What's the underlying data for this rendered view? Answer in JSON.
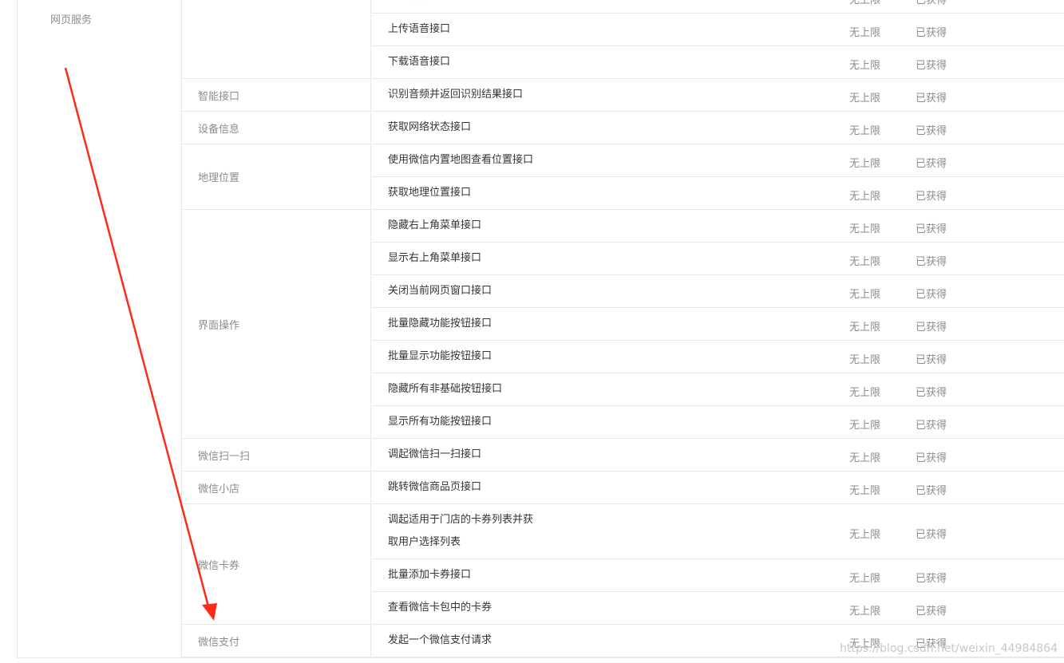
{
  "section": {
    "label": "网页服务"
  },
  "categories": [
    {
      "id": "voice",
      "label": ""
    },
    {
      "id": "smart",
      "label": "智能接口"
    },
    {
      "id": "device",
      "label": "设备信息"
    },
    {
      "id": "location",
      "label": "地理位置"
    },
    {
      "id": "ui",
      "label": "界面操作"
    },
    {
      "id": "scan",
      "label": "微信扫一扫"
    },
    {
      "id": "shop",
      "label": "微信小店"
    },
    {
      "id": "card",
      "label": "微信卡券"
    },
    {
      "id": "pay",
      "label": "微信支付"
    }
  ],
  "rows": [
    {
      "name": "停止播放接口",
      "limit": "无上限",
      "status": "已获得"
    },
    {
      "name": "上传语音接口",
      "limit": "无上限",
      "status": "已获得"
    },
    {
      "name": "下载语音接口",
      "limit": "无上限",
      "status": "已获得"
    },
    {
      "name": "识别音频并返回识别结果接口",
      "limit": "无上限",
      "status": "已获得"
    },
    {
      "name": "获取网络状态接口",
      "limit": "无上限",
      "status": "已获得"
    },
    {
      "name": "使用微信内置地图查看位置接口",
      "limit": "无上限",
      "status": "已获得"
    },
    {
      "name": "获取地理位置接口",
      "limit": "无上限",
      "status": "已获得"
    },
    {
      "name": "隐藏右上角菜单接口",
      "limit": "无上限",
      "status": "已获得"
    },
    {
      "name": "显示右上角菜单接口",
      "limit": "无上限",
      "status": "已获得"
    },
    {
      "name": "关闭当前网页窗口接口",
      "limit": "无上限",
      "status": "已获得"
    },
    {
      "name": "批量隐藏功能按钮接口",
      "limit": "无上限",
      "status": "已获得"
    },
    {
      "name": "批量显示功能按钮接口",
      "limit": "无上限",
      "status": "已获得"
    },
    {
      "name": "隐藏所有非基础按钮接口",
      "limit": "无上限",
      "status": "已获得"
    },
    {
      "name": "显示所有功能按钮接口",
      "limit": "无上限",
      "status": "已获得"
    },
    {
      "name": "调起微信扫一扫接口",
      "limit": "无上限",
      "status": "已获得"
    },
    {
      "name": "跳转微信商品页接口",
      "limit": "无上限",
      "status": "已获得"
    },
    {
      "name": "调起适用于门店的卡券列表并获取用户选择列表",
      "name_line1": "调起适用于门店的卡券列表并获",
      "name_line2": "取用户选择列表",
      "limit": "无上限",
      "status": "已获得"
    },
    {
      "name": "批量添加卡券接口",
      "limit": "无上限",
      "status": "已获得"
    },
    {
      "name": "查看微信卡包中的卡券",
      "limit": "无上限",
      "status": "已获得"
    },
    {
      "name": "发起一个微信支付请求",
      "limit": "无上限",
      "status": "已获得"
    }
  ],
  "annotation": {
    "color": "#ff2a1a"
  },
  "watermark": "https://blog.csdn.net/weixin_44984864"
}
